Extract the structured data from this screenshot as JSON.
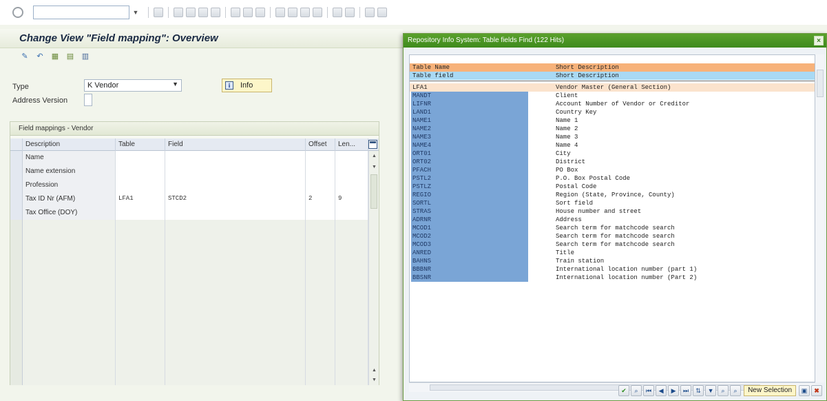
{
  "main": {
    "title": "Change View \"Field mapping\": Overview",
    "type_label": "Type",
    "type_value": "K Vendor",
    "address_version_label": "Address Version",
    "info_button": "Info",
    "table_caption": "Field mappings - Vendor",
    "columns": [
      "Description",
      "Table",
      "Field",
      "Offset",
      "Len..."
    ],
    "rows": [
      {
        "description": "Name",
        "table": "",
        "field": "",
        "offset": "",
        "length": ""
      },
      {
        "description": "Name extension",
        "table": "",
        "field": "",
        "offset": "",
        "length": ""
      },
      {
        "description": "Profession",
        "table": "",
        "field": "",
        "offset": "",
        "length": ""
      },
      {
        "description": "Tax ID Nr (AFM)",
        "table": "LFA1",
        "field": "STCD2",
        "offset": "2",
        "length": "9"
      },
      {
        "description": "Tax Office (DOY)",
        "table": "",
        "field": "",
        "offset": "",
        "length": ""
      }
    ]
  },
  "popup": {
    "title": "Repository Info System: Table fields Find (122 Hits)",
    "header": {
      "col1_a": "Table Name",
      "col2_a": "Short Description",
      "col1_b": "Table field",
      "col2_b": "Short Description"
    },
    "group": {
      "name": "LFA1",
      "description": "Vendor Master (General Section)"
    },
    "fields": [
      {
        "name": "MANDT",
        "description": "Client"
      },
      {
        "name": "LIFNR",
        "description": "Account Number of Vendor or Creditor"
      },
      {
        "name": "LAND1",
        "description": "Country Key"
      },
      {
        "name": "NAME1",
        "description": "Name 1"
      },
      {
        "name": "NAME2",
        "description": "Name 2"
      },
      {
        "name": "NAME3",
        "description": "Name 3"
      },
      {
        "name": "NAME4",
        "description": "Name 4"
      },
      {
        "name": "ORT01",
        "description": "City"
      },
      {
        "name": "ORT02",
        "description": "District"
      },
      {
        "name": "PFACH",
        "description": "PO Box"
      },
      {
        "name": "PSTL2",
        "description": "P.O. Box Postal Code"
      },
      {
        "name": "PSTLZ",
        "description": "Postal Code"
      },
      {
        "name": "REGIO",
        "description": "Region (State, Province, County)"
      },
      {
        "name": "SORTL",
        "description": "Sort field"
      },
      {
        "name": "STRAS",
        "description": "House number and street"
      },
      {
        "name": "ADRNR",
        "description": "Address"
      },
      {
        "name": "MCOD1",
        "description": "Search term for matchcode search"
      },
      {
        "name": "MCOD2",
        "description": "Search term for matchcode search"
      },
      {
        "name": "MCOD3",
        "description": "Search term for matchcode search"
      },
      {
        "name": "ANRED",
        "description": "Title"
      },
      {
        "name": "BAHNS",
        "description": "Train station"
      },
      {
        "name": "BBBNR",
        "description": "International location number  (part 1)"
      },
      {
        "name": "BBSNR",
        "description": "International location number  (Part 2)"
      }
    ],
    "new_selection_button": "New Selection"
  }
}
